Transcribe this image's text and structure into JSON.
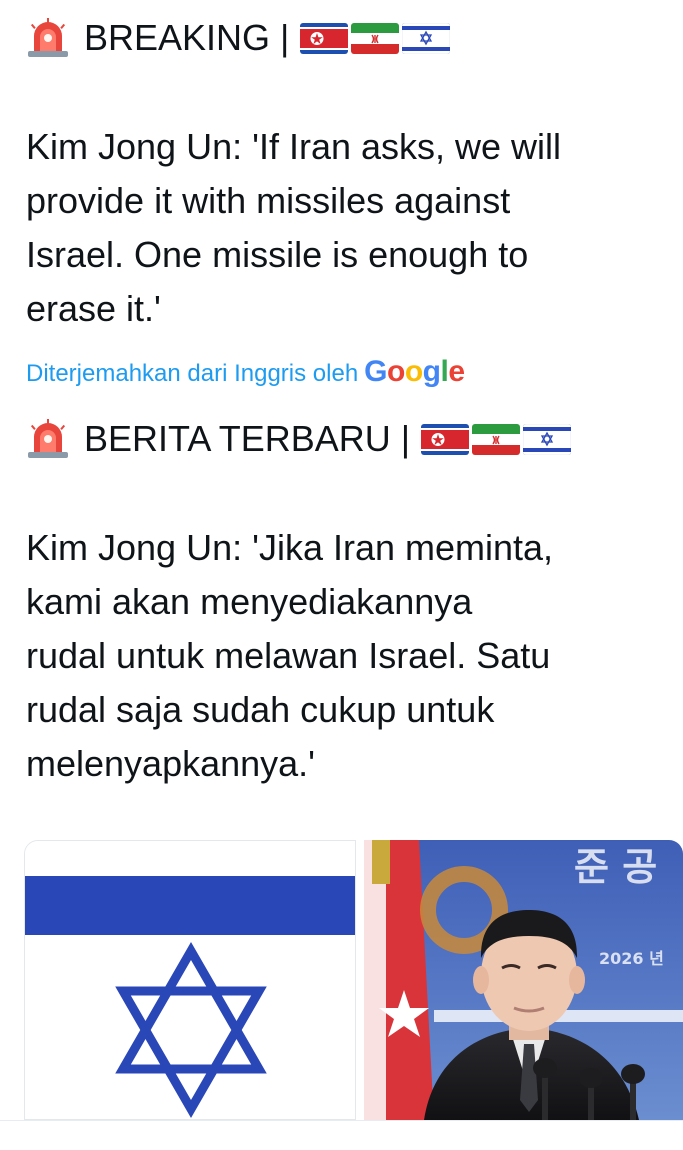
{
  "post": {
    "original": {
      "headline": "BREAKING |",
      "siren_icon": "police-car-light-icon",
      "flags": [
        "north-korea-flag-icon",
        "iran-flag-icon",
        "israel-flag-icon"
      ],
      "lines": [
        "Kim Jong Un: 'If Iran asks, we will",
        "provide it with missiles against",
        "Israel. One missile is enough to",
        "erase it.'"
      ]
    },
    "translation_note": {
      "text": "Diterjemahkan dari Inggris oleh",
      "brand": "Google"
    },
    "translated": {
      "headline": "BERITA TERBARU |",
      "siren_icon": "police-car-light-icon",
      "flags": [
        "north-korea-flag-icon",
        "iran-flag-icon",
        "israel-flag-icon"
      ],
      "lines": [
        "Kim Jong Un: 'Jika Iran meminta,",
        "kami akan menyediakannya",
        "rudal untuk melawan Israel. Satu",
        "rudal saja sudah cukup untuk",
        "melenyapkannya.'"
      ]
    },
    "media": [
      {
        "type": "image",
        "depicts": "israel-flag"
      },
      {
        "type": "image",
        "depicts": "kim-jong-un-photo",
        "background_text": "준 공",
        "background_year": "2026 년"
      }
    ]
  },
  "colors": {
    "text": "#0f1419",
    "link": "#1d9bf0",
    "israel_blue": "#2a47b8",
    "google_blue": "#4285f4",
    "google_red": "#ea4335",
    "google_yellow": "#fbbc05",
    "google_green": "#34a853"
  }
}
